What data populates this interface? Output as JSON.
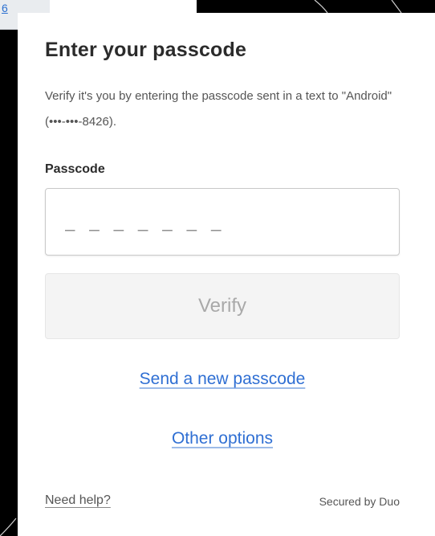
{
  "partial_link": "6",
  "card": {
    "title": "Enter your passcode",
    "description": "Verify it's you by entering the passcode sent in a text to \"Android\" (•••-•••-8426).",
    "field_label": "Passcode",
    "input": {
      "value": "",
      "placeholder": "_ _ _ _ _ _ _"
    },
    "verify_label": "Verify",
    "send_new_label": "Send a new passcode",
    "other_options_label": "Other options"
  },
  "footer": {
    "help_label": "Need help?",
    "secured_label": "Secured by Duo"
  },
  "colors": {
    "link": "#2f6fd3",
    "title": "#2b2b2b",
    "button_disabled_bg": "#f4f4f4",
    "button_disabled_text": "#a9a9a9"
  }
}
